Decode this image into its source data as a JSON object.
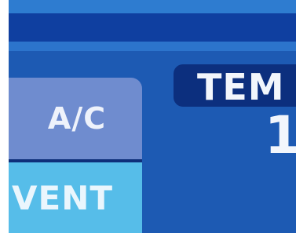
{
  "colors": {
    "screen_background": "#1d5ab3",
    "header_bar": "#0f3fa0",
    "ac_button": "#6f8ccf",
    "vent_button": "#56bde9",
    "temp_header": "#0c2f7e",
    "text": "#f2f6fc"
  },
  "mode_buttons": {
    "ac_label": "A/C",
    "vent_label": "VENT"
  },
  "temperature": {
    "header_label": "TEM",
    "value_partial": "1"
  }
}
